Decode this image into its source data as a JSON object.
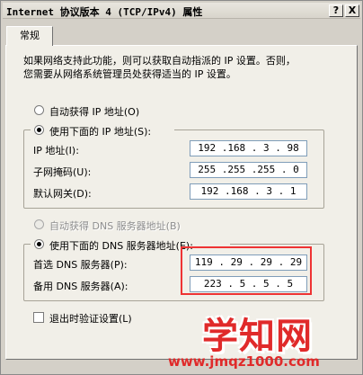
{
  "window": {
    "title": "Internet 协议版本 4 (TCP/IPv4) 属性",
    "help_button": "?",
    "close_button": "X"
  },
  "tabs": [
    {
      "label": "常规"
    }
  ],
  "description_lines": [
    "如果网络支持此功能，则可以获取自动指派的 IP 设置。否则，",
    "您需要从网络系统管理员处获得适当的 IP 设置。"
  ],
  "ip_section": {
    "auto_label": "自动获得 IP 地址(O)",
    "manual_label": "使用下面的 IP 地址(S):",
    "selected": "manual",
    "fields": [
      {
        "label": "IP 地址(I):",
        "value": "192 .168 . 3 . 98"
      },
      {
        "label": "子网掩码(U):",
        "value": "255 .255 .255 . 0"
      },
      {
        "label": "默认网关(D):",
        "value": "192 .168 . 3 . 1"
      }
    ]
  },
  "dns_section": {
    "auto_label": "自动获得 DNS 服务器地址(B)",
    "manual_label": "使用下面的 DNS 服务器地址(E):",
    "selected": "manual",
    "auto_disabled": true,
    "fields": [
      {
        "label": "首选 DNS 服务器(P):",
        "value": "119 . 29 . 29 . 29"
      },
      {
        "label": "备用 DNS 服务器(A):",
        "value": "223 . 5 . 5 . 5"
      }
    ]
  },
  "validate_checkbox": {
    "label": "退出时验证设置(L)",
    "checked": false
  },
  "watermark": {
    "text": "学知网",
    "url": "www.jmqz1000.com"
  },
  "colors": {
    "highlight": "#e33333",
    "watermark": "#e02a2a",
    "dialog_bg": "#d4d0c8",
    "panel_bg": "#f1efe8"
  }
}
